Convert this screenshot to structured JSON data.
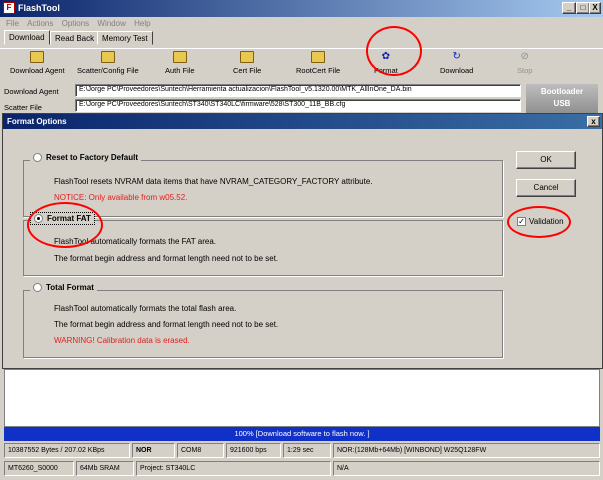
{
  "window": {
    "title": "FlashTool",
    "app_icon": "F",
    "controls": {
      "minimize": "_",
      "maximize": "□",
      "close": "X"
    }
  },
  "menu": [
    "File",
    "Actions",
    "Options",
    "Window",
    "Help"
  ],
  "tabs": [
    "Download",
    "Read Back",
    "Memory Test"
  ],
  "toolbar": {
    "download_agent": "Download Agent",
    "scatter_config": "Scatter/Config File",
    "auth_file": "Auth File",
    "cert_file": "Cert File",
    "rootcert_file": "RootCert File",
    "format": "Format",
    "download": "Download",
    "stop": "Stop"
  },
  "fields": {
    "download_agent_label": "Download Agent",
    "download_agent_value": "E:\\Jorge PC\\Proveedores\\Suntech\\Herramienta actualizacion\\FlashTool_v5.1320.00\\MTK_AllInOne_DA.bin",
    "scatter_label": "Scatter File",
    "scatter_value": "E:\\Jorge PC\\Proveedores\\Suntech\\ST340\\ST340LC\\firmware\\528\\ST300_11B_BB.cfg"
  },
  "bootloader": {
    "line1": "Bootloader",
    "line2": "USB"
  },
  "dialog": {
    "title": "Format Options",
    "close": "x",
    "reset": {
      "label": "Reset to Factory Default",
      "desc": "FlashTool resets  NVRAM data items that have NVRAM_CATEGORY_FACTORY attribute.",
      "notice": "NOTICE: Only available from w05.52."
    },
    "fat": {
      "label": "Format FAT",
      "line1": "FlashTool automatically formats the FAT area.",
      "line2": "The format begin address and  format length need not to be set."
    },
    "total": {
      "label": "Total Format",
      "line1": "FlashTool automatically formats the total flash area.",
      "line2": "The format begin address and  format length need not to be set.",
      "warning": "WARNING! Calibration data is erased."
    },
    "ok": "OK",
    "cancel": "Cancel",
    "validation": "Validation",
    "validation_checked": "✓"
  },
  "progress": {
    "text": "100% [Download software to flash now. ]",
    "percent": 100
  },
  "status1": {
    "bytes": "10387552 Bytes / 207.02 KBps",
    "flash": "NOR",
    "port": "COM8",
    "baud": "921600 bps",
    "time": "1:29 sec",
    "chip": "NOR:(128Mb+64Mb) [WINBOND] W25Q128FW"
  },
  "status2": {
    "cpu": "MT6260_S0000",
    "sram": "64Mb SRAM",
    "project": "Project: ST340LC",
    "extra": "N/A"
  },
  "colors": {
    "title_blue": "#0a246a",
    "progress_blue": "#1030c8",
    "annotation_red": "#ff0000"
  }
}
